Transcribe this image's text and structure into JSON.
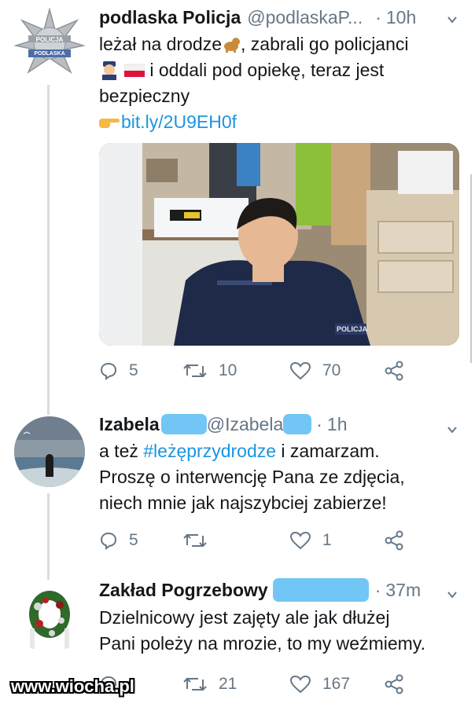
{
  "tweets": [
    {
      "name": "podlaska Policja",
      "handle": "@podlaskaP...",
      "separator": "·",
      "time": "10h",
      "text_line1_a": "leżał na drodze",
      "text_line1_b": ", zabrali go policjanci",
      "text_line2": " i oddali pod opiekę, teraz jest",
      "text_line3": "bezpieczny",
      "link": "bit.ly/2U9EH0f",
      "avatar_badge_top": "POLICJA",
      "avatar_badge_bottom": "PODLASKA",
      "photo_jacket_text": "POLICJA",
      "replies": "5",
      "retweets": "10",
      "likes": "70"
    },
    {
      "name": "Izabela",
      "handle": "@Izabela",
      "separator": "·",
      "time": "1h",
      "text_a": "a też ",
      "hashtag": "#leżęprzydrodze",
      "text_b": " i zamarzam.",
      "text_line2": "Proszę o interwencję Pana ze zdjęcia,",
      "text_line3": "niech mnie jak najszybciej zabierze!",
      "replies": "5",
      "retweets": "",
      "likes": "1"
    },
    {
      "name": "Zakład Pogrzebowy",
      "separator": "·",
      "time": "37m",
      "text_line1": "Dzielnicowy jest zajęty ale jak dłużej",
      "text_line2": "Pani poleży na mrozie, to my weźmiemy.",
      "replies": "",
      "retweets": "21",
      "likes": "167"
    }
  ],
  "watermark": "www.wiocha.pl",
  "colors": {
    "text": "#14171a",
    "secondary": "#657786",
    "link": "#1b95e0",
    "thread_line": "#d8dde2",
    "redaction": "#72c6f5"
  },
  "icons": [
    "reply-icon",
    "retweet-icon",
    "like-icon",
    "share-icon",
    "chevron-down-icon",
    "dog-emoji",
    "police-officer-emoji",
    "poland-flag-emoji",
    "pointing-hand-emoji"
  ]
}
